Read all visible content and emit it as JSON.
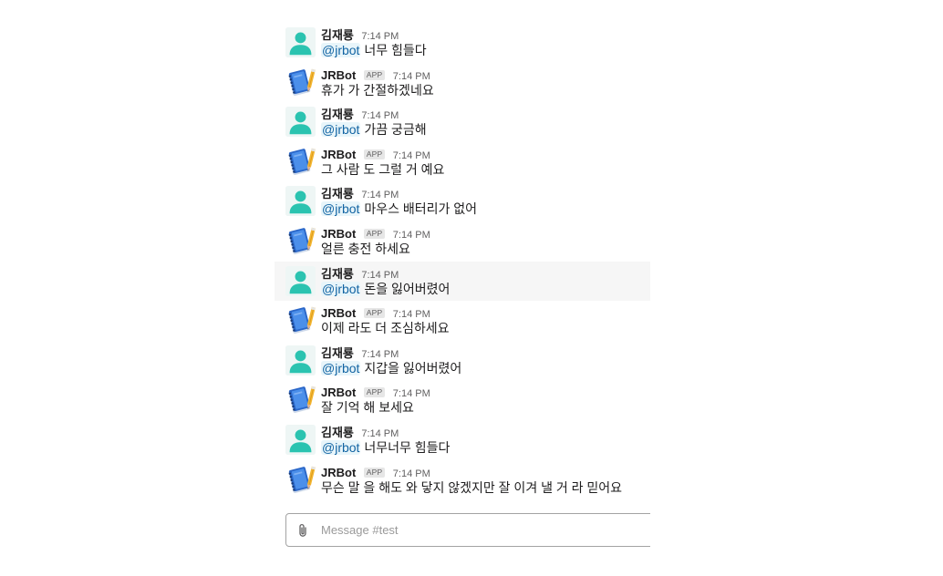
{
  "messages": [
    {
      "author": "김재룡",
      "time": "7:14 PM",
      "mention": "@jrbot",
      "text": "너무 힘들다"
    },
    {
      "author": "JRBot",
      "badge": "APP",
      "time": "7:14 PM",
      "text": "휴가 가 간절하겠네요"
    },
    {
      "author": "김재룡",
      "time": "7:14 PM",
      "mention": "@jrbot",
      "text": "가끔 궁금해"
    },
    {
      "author": "JRBot",
      "badge": "APP",
      "time": "7:14 PM",
      "text": "그 사람 도 그럴 거 예요"
    },
    {
      "author": "김재룡",
      "time": "7:14 PM",
      "mention": "@jrbot",
      "text": "마우스 배터리가 없어"
    },
    {
      "author": "JRBot",
      "badge": "APP",
      "time": "7:14 PM",
      "text": "얼른 충전 하세요"
    },
    {
      "author": "김재룡",
      "time": "7:14 PM",
      "mention": "@jrbot",
      "text": "돈을 잃어버렸어"
    },
    {
      "author": "JRBot",
      "badge": "APP",
      "time": "7:14 PM",
      "text": "이제 라도 더 조심하세요"
    },
    {
      "author": "김재룡",
      "time": "7:14 PM",
      "mention": "@jrbot",
      "text": "지갑을 잃어버렸어"
    },
    {
      "author": "JRBot",
      "badge": "APP",
      "time": "7:14 PM",
      "text": "잘 기억 해 보세요"
    },
    {
      "author": "김재룡",
      "time": "7:14 PM",
      "mention": "@jrbot",
      "text": "너무너무 힘들다"
    },
    {
      "author": "JRBot",
      "badge": "APP",
      "time": "7:14 PM",
      "text": "무슨 말 을 해도 와 닿지 않겠지만 잘 이겨 낼 거 라 믿어요"
    }
  ],
  "composer": {
    "placeholder": "Message #test",
    "value": ""
  },
  "icons": {
    "user_avatar": "person-avatar-icon",
    "bot_avatar": "notebook-pencil-avatar-icon",
    "attach": "paperclip-icon"
  },
  "colors": {
    "mention_text": "#1264a3",
    "mention_bg": "#e8f5fa",
    "user_avatar": "#2bc3b0",
    "bot_avatar": "#2a66c8",
    "hover_row_bg": "#f6f6f6"
  }
}
